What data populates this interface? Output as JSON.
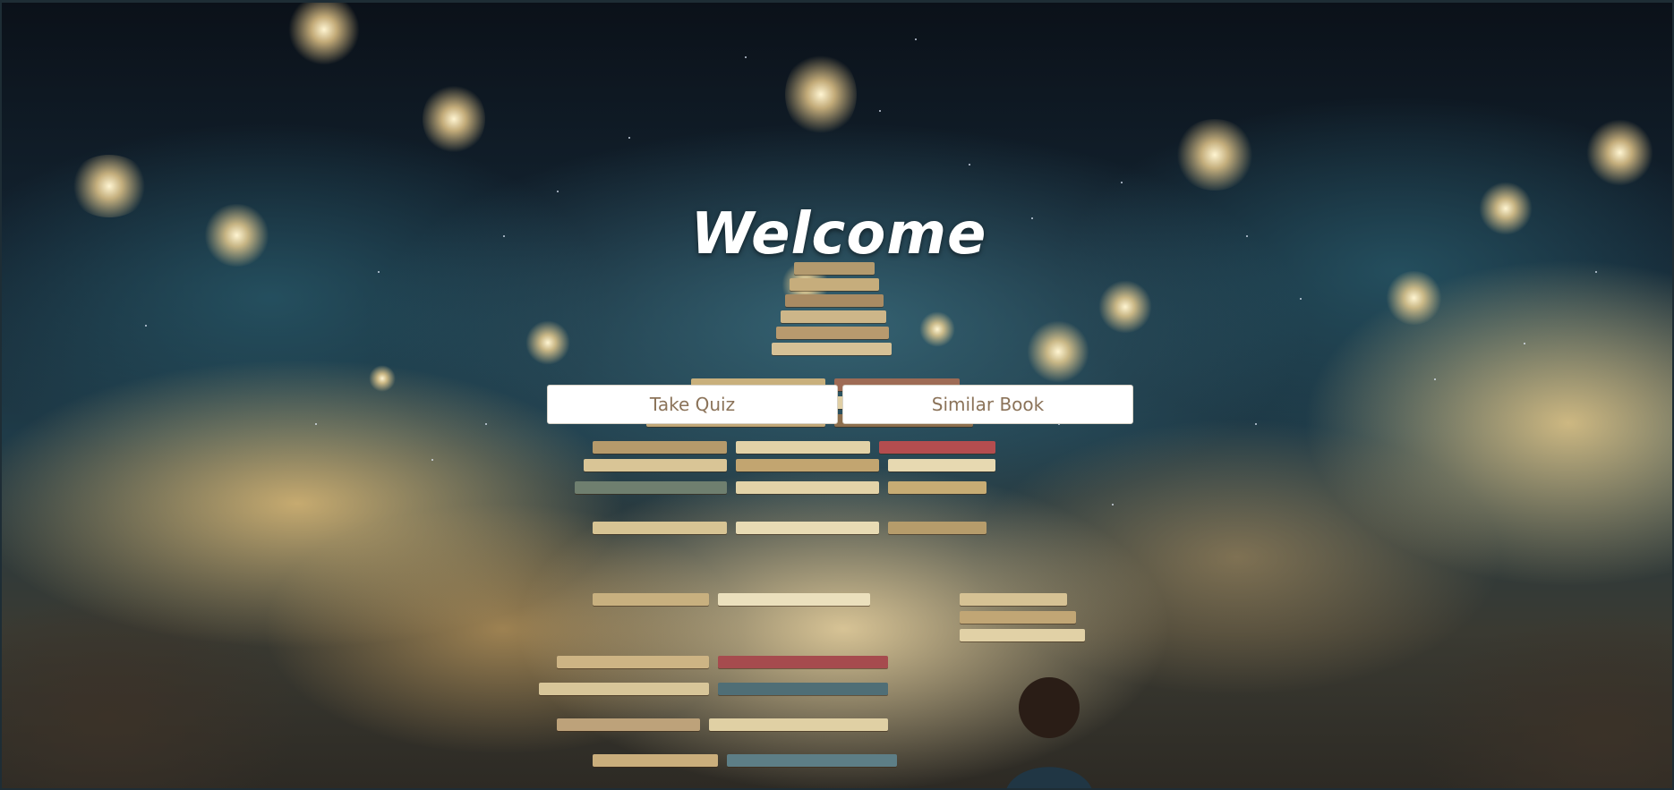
{
  "page": {
    "title": "Welcome"
  },
  "actions": {
    "quiz_label": "Take Quiz",
    "similar_label": "Similar Book"
  },
  "theme": {
    "button_background": "#ffffff",
    "button_text": "#8b7359",
    "title_color": "#ffffff"
  }
}
